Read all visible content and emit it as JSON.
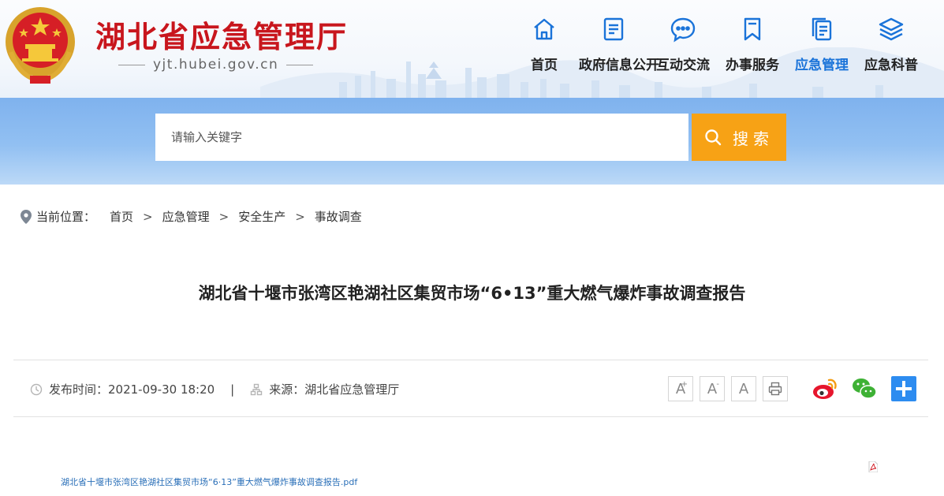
{
  "header": {
    "site_name": "湖北省应急管理厅",
    "site_url": "yjt.hubei.gov.cn"
  },
  "nav": [
    {
      "label": "首页",
      "icon": "home-icon",
      "active": false
    },
    {
      "label": "政府信息公开",
      "icon": "document-icon",
      "active": false
    },
    {
      "label": "互动交流",
      "icon": "chat-icon",
      "active": false
    },
    {
      "label": "办事服务",
      "icon": "bookmark-icon",
      "active": false
    },
    {
      "label": "应急管理",
      "icon": "files-icon",
      "active": true
    },
    {
      "label": "应急科普",
      "icon": "layers-icon",
      "active": false
    }
  ],
  "search": {
    "placeholder": "请输入关键字",
    "button_label": "搜索"
  },
  "breadcrumb": {
    "prefix": "当前位置：",
    "items": [
      "首页",
      "应急管理",
      "安全生产",
      "事故调查"
    ],
    "separator": ">"
  },
  "article": {
    "title": "湖北省十堰市张湾区艳湖社区集贸市场“6•13”重大燃气爆炸事故调查报告",
    "publish_label": "发布时间：2021-09-30 18:20",
    "pipe": "|",
    "source_label": "来源：湖北省应急管理厅",
    "attachment": "湖北省十堰市张湾区艳湖社区集贸市场“6·13”重大燃气爆炸事故调查报告.pdf"
  },
  "tools": {
    "font_large": "A",
    "font_large_sup": "+",
    "font_small": "A",
    "font_small_sup": "-",
    "font_default": "A"
  },
  "colors": {
    "brand_red": "#c8161d",
    "accent_blue": "#1a73d9",
    "search_orange": "#f7a215",
    "link_blue": "#2a6fb8"
  }
}
